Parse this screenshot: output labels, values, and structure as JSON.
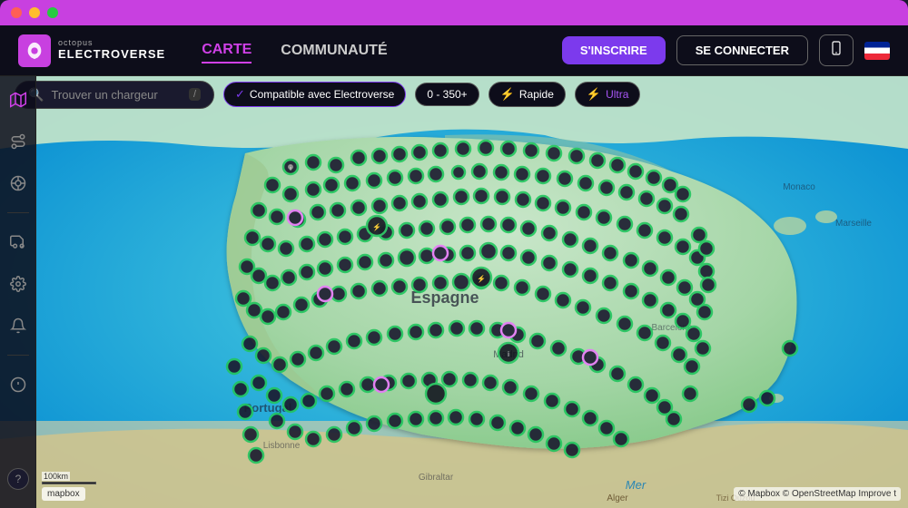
{
  "window": {
    "title": "Octopus Electroverse"
  },
  "nav": {
    "logo_top": "octopus",
    "logo_bottom": "ELECTROVERSE",
    "links": [
      {
        "id": "carte",
        "label": "CARTE",
        "active": true
      },
      {
        "id": "communaute",
        "label": "COMMUNAUTÉ",
        "active": false
      }
    ],
    "btn_register": "S'INSCRIRE",
    "btn_login": "SE CONNECTER"
  },
  "filters": {
    "search_placeholder": "Trouver un chargeur",
    "search_shortcut": "/",
    "chips": [
      {
        "id": "electroverse",
        "label": "Compatible avec Electroverse",
        "type": "electroverse"
      },
      {
        "id": "count",
        "label": "0 - 350+",
        "type": "count"
      },
      {
        "id": "fast",
        "label": "Rapide",
        "type": "fast"
      },
      {
        "id": "ultra",
        "label": "Ultra",
        "type": "ultra"
      }
    ]
  },
  "sidebar": {
    "icons": [
      {
        "id": "map",
        "symbol": "🗺",
        "label": "map-icon"
      },
      {
        "id": "route",
        "symbol": "⇌",
        "label": "route-icon"
      },
      {
        "id": "network",
        "symbol": "⊙",
        "label": "network-icon"
      },
      {
        "id": "vehicle",
        "symbol": "🚗",
        "label": "vehicle-icon"
      },
      {
        "id": "settings",
        "symbol": "⚙",
        "label": "settings-icon"
      },
      {
        "id": "notification",
        "symbol": "📢",
        "label": "notification-icon"
      },
      {
        "id": "info",
        "symbol": "ℹ",
        "label": "info-icon"
      },
      {
        "id": "help",
        "symbol": "?",
        "label": "help-icon"
      }
    ]
  },
  "map": {
    "attribution": "© Mapbox © OpenStreetMap Improve t",
    "logo": "mapbox",
    "scale_label": "100km"
  }
}
